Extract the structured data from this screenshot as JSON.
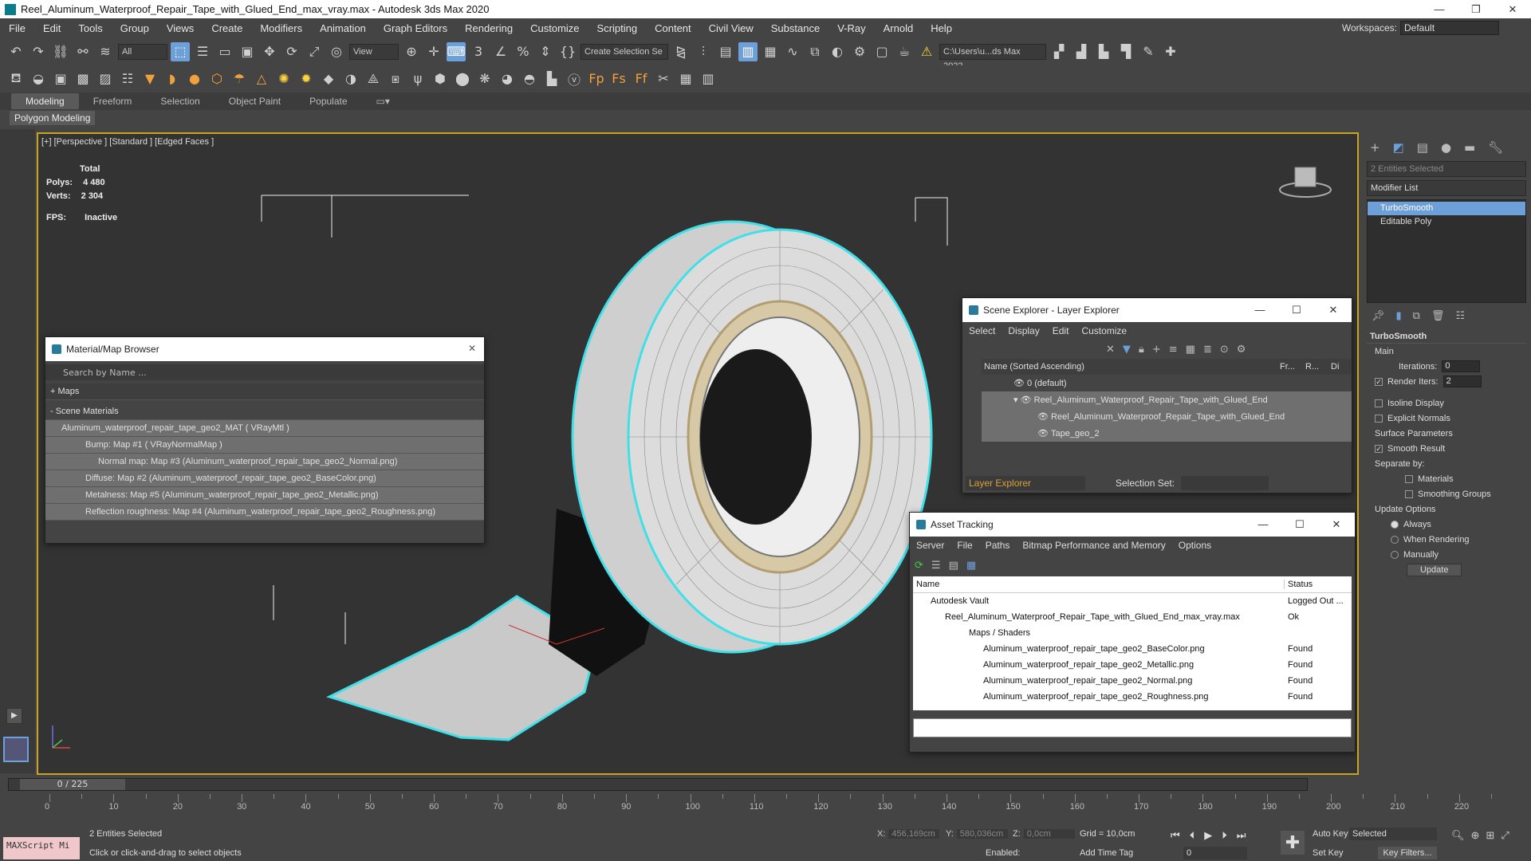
{
  "window": {
    "title": "Reel_Aluminum_Waterproof_Repair_Tape_with_Glued_End_max_vray.max - Autodesk 3ds Max 2020",
    "controls": [
      "—",
      "❐",
      "✕"
    ]
  },
  "menu": {
    "items": [
      "File",
      "Edit",
      "Tools",
      "Group",
      "Views",
      "Create",
      "Modifiers",
      "Animation",
      "Graph Editors",
      "Rendering",
      "Customize",
      "Scripting",
      "Content",
      "Civil View",
      "Substance",
      "V-Ray",
      "Arnold",
      "Help"
    ],
    "workspace_label": "Workspaces:",
    "workspace_value": "Default"
  },
  "toolbar": {
    "filter_value": "All",
    "view_value": "View",
    "selection_set_value": "Create Selection Se",
    "path_value": "C:\\Users\\u...ds Max 2022"
  },
  "ribbon": {
    "tabs": [
      "Modeling",
      "Freeform",
      "Selection",
      "Object Paint",
      "Populate"
    ],
    "sub_label": "Polygon Modeling"
  },
  "viewport": {
    "label": "[+] [Perspective ] [Standard ] [Edged Faces ]",
    "stats_header": "Total",
    "polys_label": "Polys:",
    "polys_value": "4 480",
    "verts_label": "Verts:",
    "verts_value": "2 304",
    "fps_label": "FPS:",
    "fps_value": "Inactive"
  },
  "material_browser": {
    "title": "Material/Map Browser",
    "search_placeholder": "Search by Name ...",
    "maps_label": "+ Maps",
    "scene_materials_label": "- Scene Materials",
    "items": [
      "Aluminum_waterproof_repair_tape_geo2_MAT ( VRayMtl )",
      "Bump: Map #1 ( VRayNormalMap )",
      "Normal map: Map #3 (Aluminum_waterproof_repair_tape_geo2_Normal.png)",
      "Diffuse: Map #2 (Aluminum_waterproof_repair_tape_geo2_BaseColor.png)",
      "Metalness: Map #5 (Aluminum_waterproof_repair_tape_geo2_Metallic.png)",
      "Reflection roughness: Map #4 (Aluminum_waterproof_repair_tape_geo2_Roughness.png)"
    ]
  },
  "scene_explorer": {
    "title": "Scene Explorer - Layer Explorer",
    "menu": [
      "Select",
      "Display",
      "Edit",
      "Customize"
    ],
    "col_name": "Name (Sorted Ascending)",
    "col_fr": "Fr...",
    "col_r": "R...",
    "col_di": "Di",
    "rows": [
      "0 (default)",
      "Reel_Aluminum_Waterproof_Repair_Tape_with_Glued_End",
      "Reel_Aluminum_Waterproof_Repair_Tape_with_Glued_End",
      "Tape_geo_2"
    ],
    "footer_dropdown": "Layer Explorer",
    "selection_set_label": "Selection Set:"
  },
  "asset_tracking": {
    "title": "Asset Tracking",
    "menu": [
      "Server",
      "File",
      "Paths",
      "Bitmap Performance and Memory",
      "Options"
    ],
    "col_name": "Name",
    "col_status": "Status",
    "rows": [
      {
        "name": "Autodesk Vault",
        "status": "Logged Out ..."
      },
      {
        "name": "Reel_Aluminum_Waterproof_Repair_Tape_with_Glued_End_max_vray.max",
        "status": "Ok"
      },
      {
        "name": "Maps / Shaders",
        "status": ""
      },
      {
        "name": "Aluminum_waterproof_repair_tape_geo2_BaseColor.png",
        "status": "Found"
      },
      {
        "name": "Aluminum_waterproof_repair_tape_geo2_Metallic.png",
        "status": "Found"
      },
      {
        "name": "Aluminum_waterproof_repair_tape_geo2_Normal.png",
        "status": "Found"
      },
      {
        "name": "Aluminum_waterproof_repair_tape_geo2_Roughness.png",
        "status": "Found"
      }
    ]
  },
  "command_panel": {
    "selected_label": "2 Entities Selected",
    "modifier_list": "Modifier List",
    "stack": [
      "TurboSmooth",
      "Editable Poly"
    ],
    "rollout_title": "TurboSmooth",
    "main_label": "Main",
    "iterations_label": "Iterations:",
    "iterations_value": "0",
    "render_iters_label": "Render Iters:",
    "render_iters_value": "2",
    "isoline_label": "Isoline Display",
    "explicit_label": "Explicit Normals",
    "surface_label": "Surface Parameters",
    "smooth_result_label": "Smooth Result",
    "separate_label": "Separate by:",
    "materials_label": "Materials",
    "smoothing_label": "Smoothing Groups",
    "update_options_label": "Update Options",
    "always_label": "Always",
    "when_rendering_label": "When Rendering",
    "manually_label": "Manually",
    "update_button": "Update"
  },
  "timeline": {
    "frame_display": "0 / 225",
    "ticks": [
      "0",
      "10",
      "20",
      "30",
      "40",
      "50",
      "60",
      "70",
      "80",
      "90",
      "100",
      "110",
      "120",
      "130",
      "140",
      "150",
      "160",
      "170",
      "180",
      "190",
      "200",
      "210",
      "220"
    ]
  },
  "status": {
    "maxscript": "MAXScript Mi",
    "selected": "2 Entities Selected",
    "prompt": "Click or click-and-drag to select objects",
    "x_label": "X:",
    "x_value": "456,169cm",
    "y_label": "Y:",
    "y_value": "580,036cm",
    "z_label": "Z:",
    "z_value": "0,0cm",
    "grid": "Grid = 10,0cm",
    "enabled_label": "Enabled:",
    "add_time_tag": "Add Time Tag",
    "auto_key": "Auto Key",
    "set_key": "Set Key",
    "selected_dropdown": "Selected",
    "key_filters": "Key Filters...",
    "frame_value": "0"
  },
  "colors": {
    "accent": "#6d9fd8",
    "viewport_border": "#c9a227",
    "selection_outline": "#3fe0e8"
  }
}
